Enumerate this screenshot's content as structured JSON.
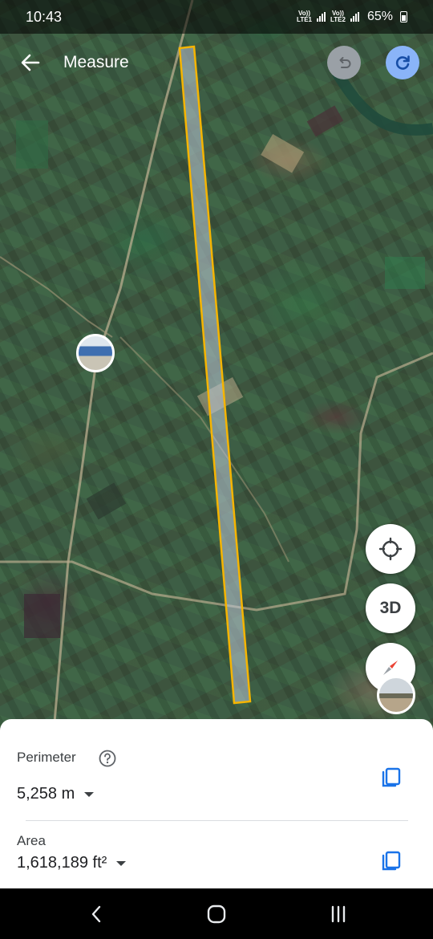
{
  "status_bar": {
    "time": "10:43",
    "sim1_top": "Vo))",
    "sim1_bottom": "LTE1",
    "sim2_top": "Vo))",
    "sim2_bottom": "LTE2",
    "battery_percent": "65%"
  },
  "header": {
    "title": "Measure",
    "icons": {
      "back": "arrow-left-icon",
      "undo": "undo-icon",
      "redo": "redo-icon"
    }
  },
  "map": {
    "measured_shape_color": "#f5b400",
    "controls": {
      "location": "my-location-icon",
      "view_3d_label": "3D",
      "compass": "compass-icon"
    }
  },
  "measurement": {
    "perimeter_label": "Perimeter",
    "perimeter_value": "5,258 m",
    "area_label": "Area",
    "area_value": "1,618,189 ft²",
    "icons": {
      "help": "help-icon",
      "copy": "copy-icon",
      "unit": "dropdown-arrow-icon"
    }
  },
  "nav_bar": {
    "icons": {
      "back": "nav-back-icon",
      "home": "nav-home-icon",
      "recents": "nav-recents-icon"
    }
  },
  "colors": {
    "accent_blue": "#1a73e8",
    "redo_button": "#8ab4f8",
    "undo_button": "#9aa0a6"
  }
}
